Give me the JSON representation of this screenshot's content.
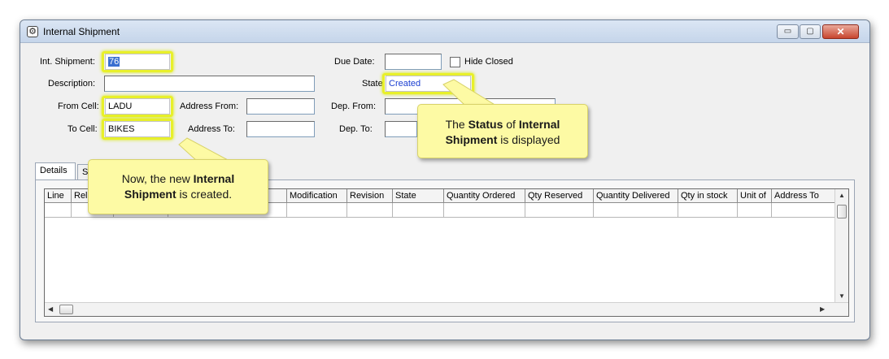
{
  "window": {
    "title": "Internal Shipment",
    "icon": "gear-icon",
    "controls": {
      "minimize": "▭",
      "maximize": "▢",
      "close": "✕"
    }
  },
  "form": {
    "int_shipment_label": "Int. Shipment:",
    "int_shipment_value": "76",
    "description_label": "Description:",
    "description_value": "",
    "from_cell_label": "From Cell:",
    "from_cell_value": "LADU",
    "to_cell_label": "To Cell:",
    "to_cell_value": "BIKES",
    "address_from_label": "Address From:",
    "address_from_value": "",
    "address_to_label": "Address To:",
    "address_to_value": "",
    "due_date_label": "Due Date:",
    "due_date_value": "",
    "hide_closed_label": "Hide Closed",
    "hide_closed_checked": false,
    "state_label": "State:",
    "state_value": "Created",
    "dep_from_label": "Dep. From:",
    "dep_from_value": "",
    "dep_to_label": "Dep. To:",
    "dep_to_value": ""
  },
  "tabs": [
    {
      "label": "Details",
      "active": true
    },
    {
      "label": "S",
      "active": false
    }
  ],
  "grid": {
    "columns": [
      "Line",
      "Rel",
      "",
      "",
      "Modification",
      "Revision",
      "State",
      "Quantity Ordered",
      "Qty Reserved",
      "Quantity Delivered",
      "Qty in stock",
      "Unit of",
      "Address To"
    ],
    "rows": []
  },
  "callouts": {
    "created": {
      "pre": "Now, the new ",
      "bold1": "Internal",
      "bold2": "Shipment",
      "post": " is created."
    },
    "status": {
      "pre": "The ",
      "bold1": "Status",
      "mid": " of ",
      "bold2": "Internal",
      "bold3": "Shipment",
      "post": " is displayed"
    }
  },
  "colors": {
    "highlight": "#e8f02a",
    "callout_bg": "#fdfaa4",
    "state_text": "#1b3fd1",
    "selection": "#3a6fd0"
  }
}
